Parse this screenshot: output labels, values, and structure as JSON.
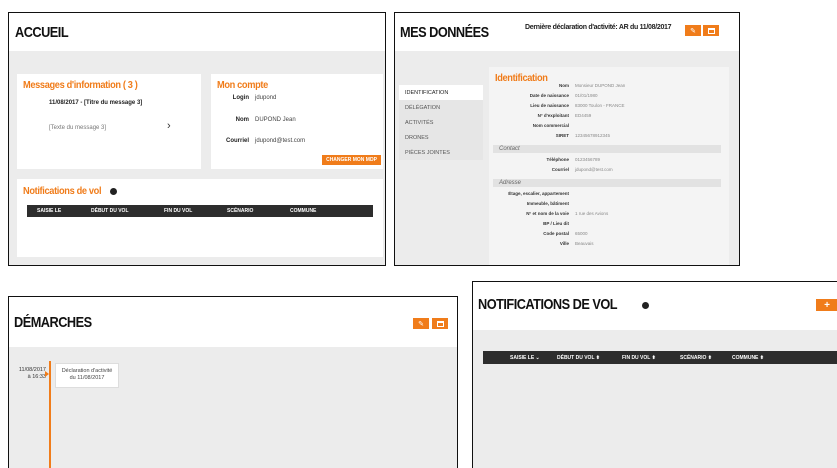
{
  "colors": {
    "accent": "#f07c1a",
    "table_header": "#2d2d2d",
    "panel_bg": "#ececec"
  },
  "accueil": {
    "title": "ACCUEIL",
    "messages": {
      "title": "Messages d'information ( 3 )",
      "item_heading": "11/08/2017 - [Titre du message 3]",
      "item_text": "[Texte du message 3]",
      "arrow": "›"
    },
    "compte": {
      "title": "Mon compte",
      "login_label": "Login",
      "login_value": "jdupond",
      "nom_label": "Nom",
      "nom_value": "DUPOND Jean",
      "courriel_label": "Courriel",
      "courriel_value": "jdupond@test.com",
      "button": "CHANGER MON MDP"
    },
    "notifications": {
      "title": "Notifications de vol",
      "columns": [
        "SAISIE LE",
        "DÉBUT DU VOL",
        "FIN DU VOL",
        "SCÉNARIO",
        "COMMUNE"
      ]
    }
  },
  "donnees": {
    "title": "MES DONNÉES",
    "subtitle": "Dernière déclaration d'activité: AR du 11/08/2017",
    "menu": [
      "IDENTIFICATION",
      "DÉLÉGATION",
      "ACTIVITÉS",
      "DRONES",
      "PIÈCES JOINTES"
    ],
    "section_title": "Identification",
    "fields": [
      {
        "label": "Nom",
        "value": "Monsieur DUPOND Jean"
      },
      {
        "label": "Date de naissance",
        "value": "01/01/1980"
      },
      {
        "label": "Lieu de naissance",
        "value": "83000 Toulon - FRANCE"
      },
      {
        "label": "N° d'exploitant",
        "value": "ED4459"
      },
      {
        "label": "Nom commercial",
        "value": ""
      },
      {
        "label": "SIRET",
        "value": "12345678912345"
      }
    ],
    "contact_title": "Contact",
    "contact": [
      {
        "label": "Téléphone",
        "value": "0123456789"
      },
      {
        "label": "Courriel",
        "value": "jdupond@test.com"
      }
    ],
    "adresse_title": "Adresse",
    "adresse": [
      {
        "label": "Étage, escalier, appartement",
        "value": ""
      },
      {
        "label": "Immeuble, bâtiment",
        "value": ""
      },
      {
        "label": "N° et nom de la voie",
        "value": "1 rue des Avions"
      },
      {
        "label": "BP / Lieu dit",
        "value": ""
      },
      {
        "label": "Code postal",
        "value": "65000"
      },
      {
        "label": "Ville",
        "value": "Beauvais"
      }
    ]
  },
  "demarches": {
    "title": "DÉMARCHES",
    "date": "11/08/2017",
    "time": "à 16:33",
    "event": "Déclaration d'activité du 11/08/2017"
  },
  "notifs": {
    "title": "NOTIFICATIONS DE VOL",
    "add_button": "+",
    "columns": [
      "SAISIE LE ⌄",
      "DÉBUT DU VOL ⬍",
      "FIN DU VOL ⬍",
      "SCÉNARIO ⬍",
      "COMMUNE ⬍"
    ]
  }
}
